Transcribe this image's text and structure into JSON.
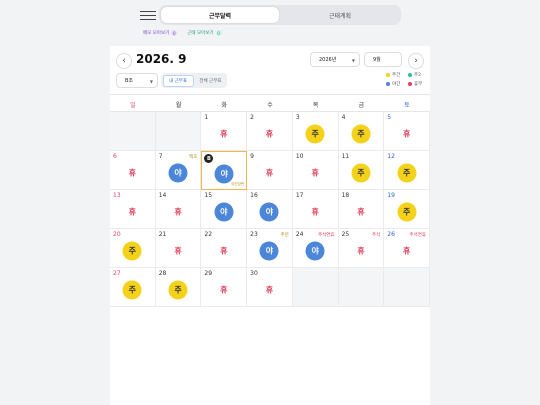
{
  "tabs": {
    "active": "근무달력",
    "inactive": "근태계획"
  },
  "chips": [
    {
      "label": "메모 모아보기",
      "count": "0",
      "color": "#7a3fd1"
    },
    {
      "label": "근태 모아보기",
      "count": "0",
      "color": "#1e9b6e"
    }
  ],
  "header": {
    "month_title": "2026. 9",
    "prev_icon": "‹",
    "next_icon": "›",
    "year_select": "2026년",
    "month_select": "9월",
    "team_select": "B조",
    "view_my": "내 근무표",
    "view_all": "전체 근무표"
  },
  "legend": [
    {
      "label": "주간",
      "color": "#f5d21a"
    },
    {
      "label": "주2",
      "color": "#2bbfa0"
    },
    {
      "label": "야간",
      "color": "#4b86d9"
    },
    {
      "label": "휴무",
      "color": "#e0435c"
    }
  ],
  "weekdays": [
    "일",
    "월",
    "화",
    "수",
    "목",
    "금",
    "토"
  ],
  "shift_labels": {
    "rest": "휴",
    "day": "주",
    "night": "야"
  },
  "colors": {
    "day": "#f5d21a",
    "night": "#4b86d9",
    "rest": "#e0435c",
    "today_border": "#f1b64a"
  },
  "weeks": [
    [
      null,
      null,
      {
        "day": "1",
        "shift": "rest"
      },
      {
        "day": "2",
        "shift": "rest"
      },
      {
        "day": "3",
        "shift": "day"
      },
      {
        "day": "4",
        "shift": "day"
      },
      {
        "day": "5",
        "shift": "rest"
      }
    ],
    [
      {
        "day": "6",
        "shift": "rest"
      },
      {
        "day": "7",
        "shift": "night",
        "note": "백호",
        "note_gold": true
      },
      {
        "day": "8",
        "shift": "night",
        "today": true,
        "badge": "B",
        "tiny": "야간당번"
      },
      {
        "day": "9",
        "shift": "rest"
      },
      {
        "day": "10",
        "shift": "rest"
      },
      {
        "day": "11",
        "shift": "day"
      },
      {
        "day": "12",
        "shift": "day"
      }
    ],
    [
      {
        "day": "13",
        "shift": "rest"
      },
      {
        "day": "14",
        "shift": "rest"
      },
      {
        "day": "15",
        "shift": "night"
      },
      {
        "day": "16",
        "shift": "night"
      },
      {
        "day": "17",
        "shift": "rest"
      },
      {
        "day": "18",
        "shift": "rest"
      },
      {
        "day": "19",
        "shift": "day"
      }
    ],
    [
      {
        "day": "20",
        "shift": "day"
      },
      {
        "day": "21",
        "shift": "rest"
      },
      {
        "day": "22",
        "shift": "rest"
      },
      {
        "day": "23",
        "shift": "night",
        "note": "추분",
        "note_gold": true
      },
      {
        "day": "24",
        "shift": "night",
        "note": "추석연휴"
      },
      {
        "day": "25",
        "shift": "rest",
        "note": "추석"
      },
      {
        "day": "26",
        "shift": "rest",
        "note": "추석연휴"
      }
    ],
    [
      {
        "day": "27",
        "shift": "day"
      },
      {
        "day": "28",
        "shift": "day"
      },
      {
        "day": "29",
        "shift": "rest"
      },
      {
        "day": "30",
        "shift": "rest"
      },
      null,
      null,
      null
    ]
  ]
}
